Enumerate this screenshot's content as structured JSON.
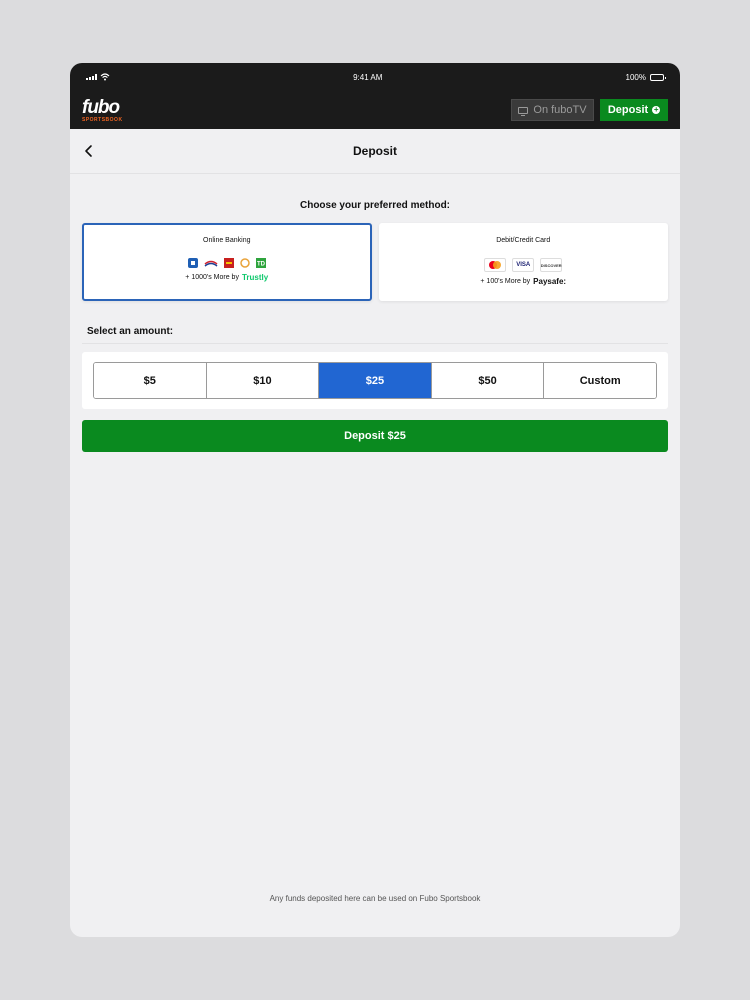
{
  "status": {
    "time": "9:41 AM",
    "battery": "100%"
  },
  "brand": {
    "name": "fubo",
    "sub": "SPORTSBOOK"
  },
  "header": {
    "tv_label": "On fuboTV",
    "deposit_label": "Deposit"
  },
  "nav": {
    "title": "Deposit"
  },
  "methods": {
    "heading": "Choose your preferred method:",
    "online": {
      "title": "Online Banking",
      "more": "+ 1000's More by",
      "provider": "Trustly"
    },
    "card": {
      "title": "Debit/Credit Card",
      "more": "+ 100's More by",
      "provider": "Paysafe:"
    }
  },
  "amount": {
    "label": "Select an amount:",
    "options": [
      "$5",
      "$10",
      "$25",
      "$50",
      "Custom"
    ],
    "selected": "$25"
  },
  "cta": {
    "label": "Deposit $25"
  },
  "footer": {
    "note": "Any funds deposited here can be used on Fubo Sportsbook"
  },
  "colors": {
    "brand_green": "#0a8a1f",
    "selected_blue": "#2166d2",
    "brand_orange": "#f26522"
  }
}
